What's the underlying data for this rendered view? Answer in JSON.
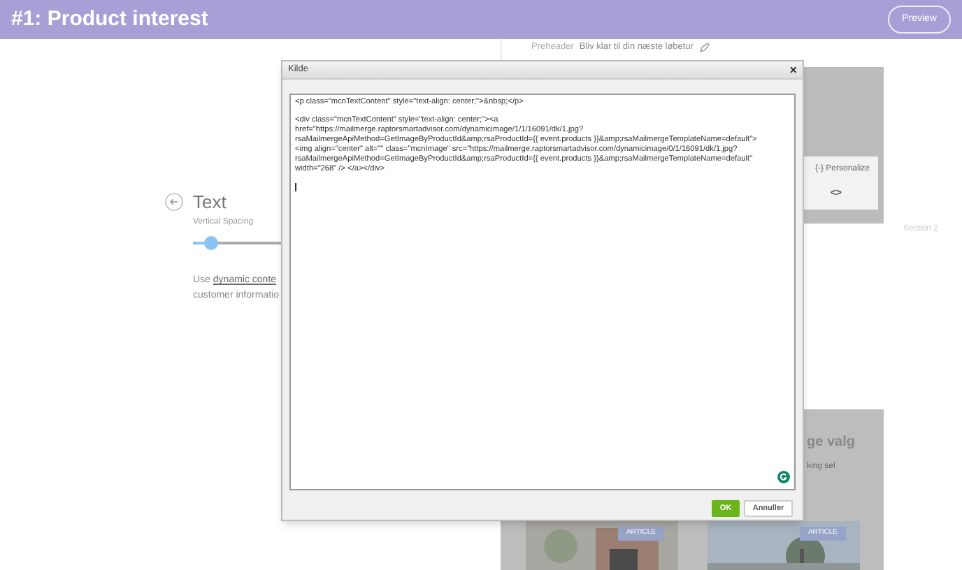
{
  "header": {
    "title": "#1: Product interest",
    "preview_button": "Preview"
  },
  "editor_panel": {
    "title": "Text",
    "spacing_label": "Vertical Spacing",
    "spacing": {
      "level": 0.2
    },
    "help_before": "Use ",
    "help_link": "dynamic conte",
    "help_line2": "customer informatio"
  },
  "email_preview": {
    "preheader_label": "Preheader",
    "preheader_text": "Bliv klar til din næste løbetur",
    "personalize": "{-} Personalize",
    "code_toggle": "<>",
    "section_title": "ge valg",
    "section_text": "king sel",
    "cards": [
      {
        "badge": "ARTICLE"
      },
      {
        "badge": "ARTICLE"
      }
    ]
  },
  "outline": [
    {
      "label": "Section 2"
    }
  ],
  "dialog": {
    "title": "Kilde",
    "close": "×",
    "source_paragraphs": [
      [
        "<p class=\"mcnTextContent\" style=\"text-align: center;\">&nbsp;</p>"
      ],
      [
        "<div class=\"mcnTextContent\" style=\"text-align: center;\"><a",
        "href=\"https://mailmerge.raptorsmartadvisor.com/dynamicimage/1/1/16091/dk/1.jpg?",
        "rsaMailmergeApiMethod=GetImageByProductId&amp;rsaProductId={{ event.products }}&amp;rsaMailmergeTemplateName=default\">",
        "<img align=\"center\" alt=\"\" class=\"mcnImage\" src=\"https://mailmerge.raptorsmartadvisor.com/dynamicimage/0/1/16091/dk/1.jpg?",
        "rsaMailmergeApiMethod=GetImageByProductId&amp;rsaProductId={{ event.products }}&amp;rsaMailmergeTemplateName=default\"",
        "width=\"268\" /> </a></div>"
      ]
    ],
    "ok": "OK",
    "cancel": "Annuller"
  }
}
